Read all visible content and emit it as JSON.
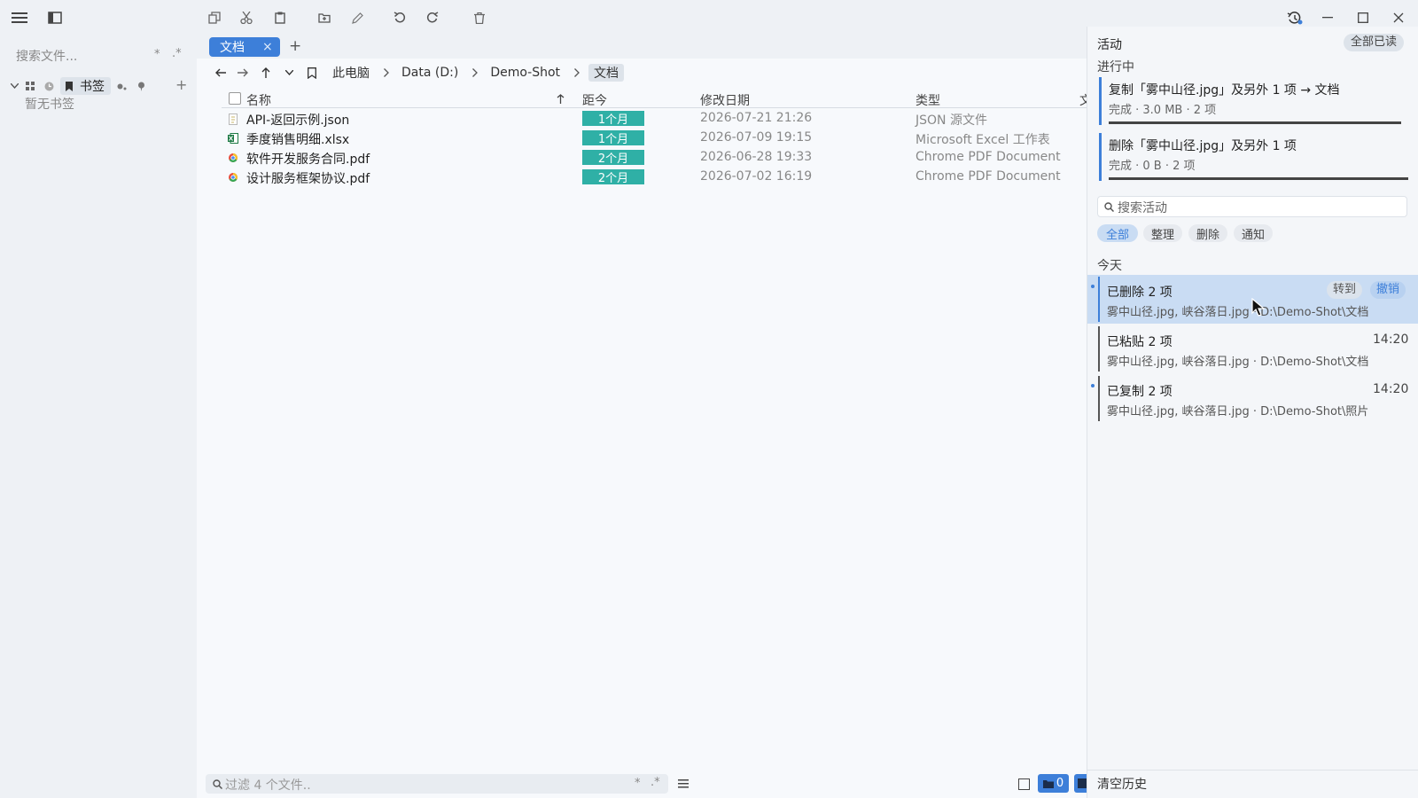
{
  "sidebar": {
    "search_placeholder": "搜索文件...",
    "search_opt1": "*",
    "search_opt2": ".*",
    "bookmark_tab": "书签",
    "empty_bookmarks": "暂无书签",
    "add": "+"
  },
  "tabs": [
    {
      "label": "文档",
      "close": "×"
    }
  ],
  "new_tab": "+",
  "breadcrumb": [
    "此电脑",
    "Data (D:)",
    "Demo-Shot",
    "文档"
  ],
  "columns": {
    "name": "名称",
    "age": "距今",
    "modified": "修改日期",
    "type": "类型",
    "more": "文"
  },
  "files": [
    {
      "name": "API-返回示例.json",
      "age": "1个月",
      "modified": "2026-07-21 21:26",
      "type": "JSON 源文件",
      "icon": "json-file-icon"
    },
    {
      "name": "季度销售明细.xlsx",
      "age": "1个月",
      "modified": "2026-07-09 19:15",
      "type": "Microsoft Excel 工作表",
      "icon": "excel-file-icon"
    },
    {
      "name": "软件开发服务合同.pdf",
      "age": "2个月",
      "modified": "2026-06-28 19:33",
      "type": "Chrome PDF Document",
      "icon": "pdf-file-icon"
    },
    {
      "name": "设计服务框架协议.pdf",
      "age": "2个月",
      "modified": "2026-07-02 16:19",
      "type": "Chrome PDF Document",
      "icon": "pdf-file-icon"
    }
  ],
  "status_bar": {
    "filter_placeholder": "过滤 4 个文件..",
    "opt1": "*",
    "opt2": ".*",
    "folder_count": "0"
  },
  "activity": {
    "title": "活动",
    "mark_all_read": "全部已读",
    "in_progress_label": "进行中",
    "in_progress": [
      {
        "title": "复制「雾中山径.jpg」及另外 1 项 → 文档",
        "detail": "完成 · 3.0 MB · 2 项",
        "progress": 1.0
      },
      {
        "title": "删除「雾中山径.jpg」及另外 1 项",
        "detail": "完成 · 0 B · 2 项",
        "progress": 1.0
      }
    ],
    "search_placeholder": "搜索活动",
    "filters": [
      "全部",
      "整理",
      "删除",
      "通知"
    ],
    "today_label": "今天",
    "items": [
      {
        "title": "已删除 2 项",
        "detail": "雾中山径.jpg, 峡谷落日.jpg · D:\\Demo-Shot\\文档",
        "action1": "转到",
        "action2": "撤销",
        "time": ""
      },
      {
        "title": "已粘贴 2 项",
        "detail": "雾中山径.jpg, 峡谷落日.jpg · D:\\Demo-Shot\\文档",
        "time": "14:20"
      },
      {
        "title": "已复制 2 项",
        "detail": "雾中山径.jpg, 峡谷落日.jpg · D:\\Demo-Shot\\照片",
        "time": "14:20"
      }
    ],
    "clear_history": "清空历史"
  },
  "colors": {
    "accent": "#3d7fd9",
    "age_badge": "#2fb0a6",
    "highlight": "#c9dcf3"
  }
}
